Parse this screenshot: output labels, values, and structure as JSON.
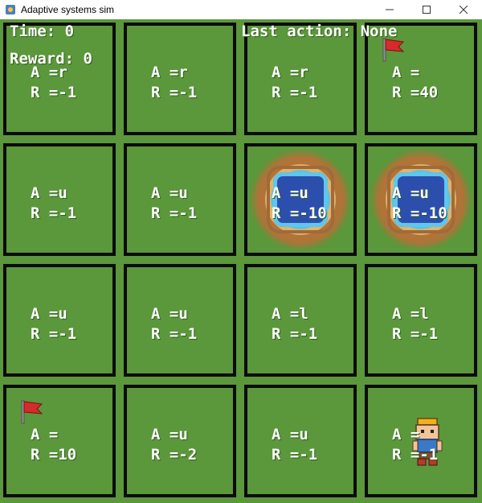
{
  "window": {
    "title": "Adaptive systems sim",
    "controls": [
      "minimize",
      "maximize",
      "close"
    ]
  },
  "hud": {
    "time_label": "Time:",
    "time_value": "0",
    "reward_label": "Reward:",
    "reward_value": "0",
    "last_action_label": "Last action:",
    "last_action_value": "None"
  },
  "grid": {
    "rows": [
      [
        {
          "action": "r",
          "reward": "-1"
        },
        {
          "action": "r",
          "reward": "-1"
        },
        {
          "action": "r",
          "reward": "-1"
        },
        {
          "action": "",
          "reward": "40",
          "flag": true
        }
      ],
      [
        {
          "action": "u",
          "reward": "-1"
        },
        {
          "action": "u",
          "reward": "-1"
        },
        {
          "action": "u",
          "reward": "-10",
          "pond": true
        },
        {
          "action": "u",
          "reward": "-10",
          "pond": true
        }
      ],
      [
        {
          "action": "u",
          "reward": "-1"
        },
        {
          "action": "u",
          "reward": "-1"
        },
        {
          "action": "l",
          "reward": "-1"
        },
        {
          "action": "l",
          "reward": "-1"
        }
      ],
      [
        {
          "action": "",
          "reward": "10",
          "flag": true
        },
        {
          "action": "u",
          "reward": "-2"
        },
        {
          "action": "u",
          "reward": "-1"
        },
        {
          "action": "",
          "reward": "-1",
          "player": true
        }
      ]
    ]
  },
  "labels": {
    "action_prefix": "A =",
    "reward_prefix": "R ="
  },
  "colors": {
    "grass": "#5b973b",
    "cell_border": "#0b0b0b",
    "text": "#ffffff",
    "water": "#2c4fae",
    "flag": "#d62b2b"
  }
}
